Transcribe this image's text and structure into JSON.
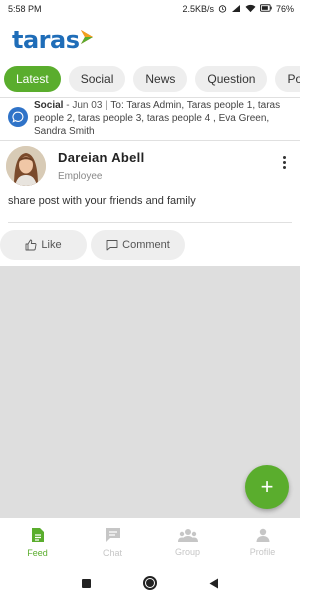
{
  "status_bar": {
    "time": "5:58 PM",
    "net_speed": "2.5KB/s",
    "battery": "76%"
  },
  "app": {
    "logo_text": "taras",
    "brand_color": "#1f6db8",
    "accent_color": "#5aad2d"
  },
  "tabs": [
    {
      "label": "Latest",
      "active": true
    },
    {
      "label": "Social",
      "active": false
    },
    {
      "label": "News",
      "active": false
    },
    {
      "label": "Question",
      "active": false
    },
    {
      "label": "Poll",
      "active": false
    }
  ],
  "post": {
    "type": "Social",
    "date": "- Jun 03",
    "separator": "|",
    "recipients": "To: Taras Admin, Taras people 1, taras people 2, taras people 3, taras people 4 , Eva Green, Sandra Smith",
    "type_icon": "chat-bubble-icon",
    "author": {
      "name": "Dareian Abell",
      "role": "Employee"
    },
    "body": "share post with your friends and family",
    "actions": {
      "like_label": "Like",
      "comment_label": "Comment"
    }
  },
  "fab": {
    "label": "+"
  },
  "bottom_nav": [
    {
      "label": "Feed",
      "icon": "document-icon",
      "active": true
    },
    {
      "label": "Chat",
      "icon": "chat-icon",
      "active": false
    },
    {
      "label": "Group",
      "icon": "group-icon",
      "active": false
    },
    {
      "label": "Profile",
      "icon": "person-icon",
      "active": false
    }
  ]
}
